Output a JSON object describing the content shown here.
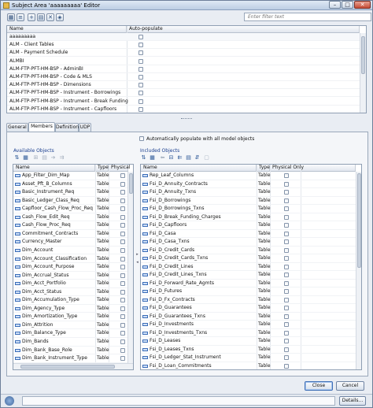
{
  "window": {
    "title": "Subject Area 'aaaaaaaaa' Editor",
    "controls": {
      "minimize": "–",
      "maximize": "□",
      "close": "✕"
    }
  },
  "toolbar": {
    "icons": [
      "grid-icon",
      "columns-icon",
      "new-icon",
      "properties-icon",
      "delete-icon",
      "link-icon"
    ],
    "filter_placeholder": "Enter filter text"
  },
  "top_table": {
    "headers": {
      "name": "Name",
      "auto_populate": "Auto-populate"
    },
    "rows": [
      "aaaaaaaaa",
      "ALM - Client Tables",
      "ALM - Payment Schedule",
      "ALMBI",
      "ALM-FTP-PFT-HM-BSP - AdminBI",
      "ALM-FTP-PFT-HM-BSP - Code & MLS",
      "ALM-FTP-PFT-HM-BSP - Dimensions",
      "ALM-FTP-PFT-HM-BSP - Instrument - Borrowings",
      "ALM-FTP-PFT-HM-BSP - Instrument - Break Funding",
      "ALM-FTP-PFT-HM-BSP - Instrument - Capfloors"
    ]
  },
  "tabs": [
    "General",
    "Members",
    "Definition",
    "UDP"
  ],
  "active_tab": "Members",
  "auto_populate_label": "Automatically populate with all model objects",
  "available": {
    "label": "Available Objects",
    "headers": {
      "name": "Name",
      "type": "Type",
      "physical": "Physical"
    },
    "rows": [
      {
        "name": "App_Filter_Dim_Map",
        "type": "Table"
      },
      {
        "name": "Asset_Pft_B_Columns",
        "type": "Table"
      },
      {
        "name": "Basic_Instrument_Req",
        "type": "Table"
      },
      {
        "name": "Basic_Ledger_Class_Req",
        "type": "Table"
      },
      {
        "name": "Capfloor_Cash_Flow_Proc_Req",
        "type": "Table"
      },
      {
        "name": "Cash_Flow_Edit_Req",
        "type": "Table"
      },
      {
        "name": "Cash_Flow_Proc_Req",
        "type": "Table"
      },
      {
        "name": "Commitment_Contracts",
        "type": "Table"
      },
      {
        "name": "Currency_Master",
        "type": "Table"
      },
      {
        "name": "Dim_Account",
        "type": "Table"
      },
      {
        "name": "Dim_Account_Classification",
        "type": "Table"
      },
      {
        "name": "Dim_Account_Purpose",
        "type": "Table"
      },
      {
        "name": "Dim_Accrual_Status",
        "type": "Table"
      },
      {
        "name": "Dim_Acct_Portfolio",
        "type": "Table"
      },
      {
        "name": "Dim_Acct_Status",
        "type": "Table"
      },
      {
        "name": "Dim_Accumulation_Type",
        "type": "Table"
      },
      {
        "name": "Dim_Agency_Type",
        "type": "Table"
      },
      {
        "name": "Dim_Amortization_Type",
        "type": "Table"
      },
      {
        "name": "Dim_Attrition",
        "type": "Table"
      },
      {
        "name": "Dim_Balance_Type",
        "type": "Table"
      },
      {
        "name": "Dim_Bands",
        "type": "Table"
      },
      {
        "name": "Dim_Bank_Base_Role",
        "type": "Table"
      },
      {
        "name": "Dim_Bank_Instrument_Type",
        "type": "Table"
      }
    ]
  },
  "included": {
    "label": "Included Objects",
    "headers": {
      "name": "Name",
      "type": "Type",
      "physical": "Physical Only"
    },
    "rows": [
      {
        "name": "Rep_Leaf_Columns",
        "type": "Table"
      },
      {
        "name": "Fsi_D_Annuity_Contracts",
        "type": "Table"
      },
      {
        "name": "Fsi_D_Annuity_Txns",
        "type": "Table"
      },
      {
        "name": "Fsi_D_Borrowings",
        "type": "Table"
      },
      {
        "name": "Fsi_D_Borrowings_Txns",
        "type": "Table"
      },
      {
        "name": "Fsi_D_Break_Funding_Charges",
        "type": "Table"
      },
      {
        "name": "Fsi_D_Capfloors",
        "type": "Table"
      },
      {
        "name": "Fsi_D_Casa",
        "type": "Table"
      },
      {
        "name": "Fsi_D_Casa_Txns",
        "type": "Table"
      },
      {
        "name": "Fsi_D_Credit_Cards",
        "type": "Table"
      },
      {
        "name": "Fsi_D_Credit_Cards_Txns",
        "type": "Table"
      },
      {
        "name": "Fsi_D_Credit_Lines",
        "type": "Table"
      },
      {
        "name": "Fsi_D_Credit_Lines_Txns",
        "type": "Table"
      },
      {
        "name": "Fsi_D_Forward_Rate_Agmts",
        "type": "Table"
      },
      {
        "name": "Fsi_D_Futures",
        "type": "Table"
      },
      {
        "name": "Fsi_D_Fx_Contracts",
        "type": "Table"
      },
      {
        "name": "Fsi_D_Guarantees",
        "type": "Table"
      },
      {
        "name": "Fsi_D_Guarantees_Txns",
        "type": "Table"
      },
      {
        "name": "Fsi_D_Investments",
        "type": "Table"
      },
      {
        "name": "Fsi_D_Investments_Txns",
        "type": "Table"
      },
      {
        "name": "Fsi_D_Leases",
        "type": "Table"
      },
      {
        "name": "Fsi_D_Leases_Txns",
        "type": "Table"
      },
      {
        "name": "Fsi_D_Ledger_Stat_Instrument",
        "type": "Table"
      },
      {
        "name": "Fsi_D_Loan_Commitments",
        "type": "Table"
      }
    ]
  },
  "buttons": {
    "close": "Close",
    "cancel": "Cancel",
    "details": "Details..."
  },
  "colors": {
    "accent": "#3f6fb6",
    "section_label": "#1b3f8f",
    "window_bg": "#e9edf3"
  }
}
